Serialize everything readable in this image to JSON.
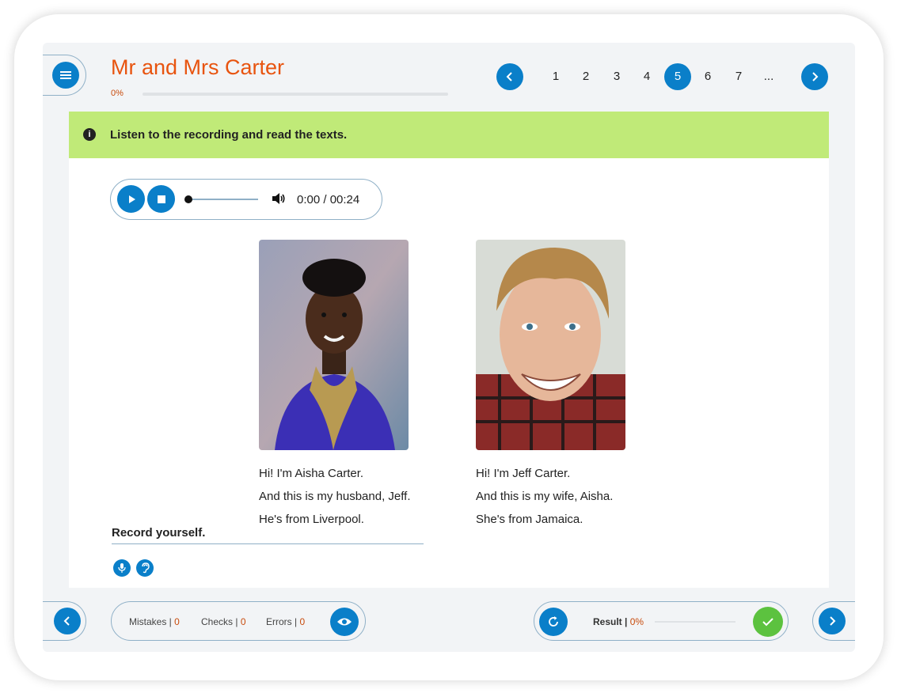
{
  "header": {
    "title": "Mr and Mrs Carter",
    "progress_text": "0%",
    "progress_value": 0,
    "pages": [
      "1",
      "2",
      "3",
      "4",
      "5",
      "6",
      "7",
      "..."
    ],
    "active_page": "5"
  },
  "banner": {
    "instruction": "Listen to the recording and read the texts."
  },
  "player": {
    "time": "0:00 / 00:24"
  },
  "people": [
    {
      "lines": [
        "Hi! I'm Aisha Carter.",
        "And this is my husband, Jeff.",
        "He's from Liverpool."
      ]
    },
    {
      "lines": [
        "Hi! I'm Jeff Carter.",
        "And this is my wife, Aisha.",
        "She's from Jamaica."
      ]
    }
  ],
  "record": {
    "label": "Record yourself."
  },
  "footer": {
    "mistakes_label": "Mistakes |",
    "mistakes_value": "0",
    "checks_label": "Checks |",
    "checks_value": "0",
    "errors_label": "Errors |",
    "errors_value": "0",
    "result_label": "Result |",
    "result_value": "0%"
  },
  "colors": {
    "accent": "#0a7fc9",
    "title": "#e8540f",
    "banner": "#c0ea78",
    "check": "#5cc23f"
  },
  "icons": [
    "menu-icon",
    "chevron-left-icon",
    "chevron-right-icon",
    "info-icon",
    "play-icon",
    "stop-icon",
    "volume-icon",
    "microphone-icon",
    "ear-icon",
    "eye-icon",
    "refresh-icon",
    "check-icon"
  ]
}
